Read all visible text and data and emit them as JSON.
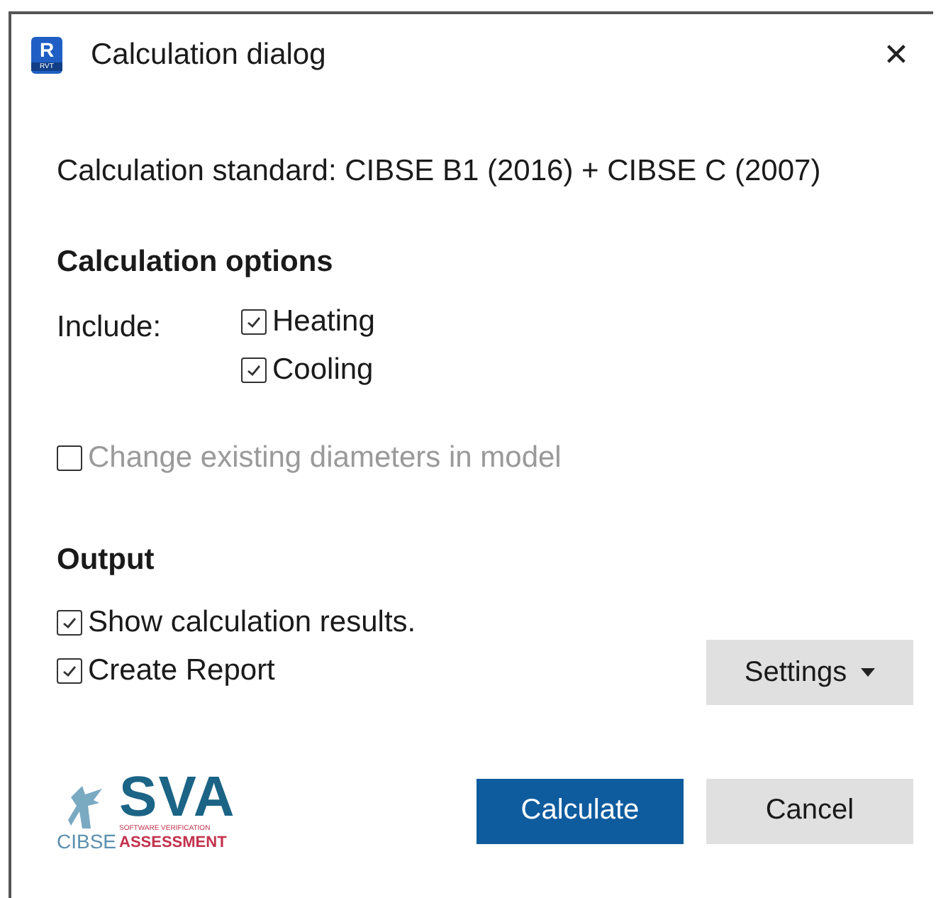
{
  "window": {
    "title": "Calculation dialog",
    "app_icon_letter": "R",
    "app_icon_caption": "RVT",
    "close": "✕"
  },
  "standard": "Calculation standard: CIBSE B1 (2016) + CIBSE C (2007)",
  "options": {
    "heading": "Calculation options",
    "include_label": "Include:",
    "items": [
      {
        "label": "Heating",
        "checked": true,
        "disabled": false
      },
      {
        "label": "Cooling",
        "checked": true,
        "disabled": false
      }
    ]
  },
  "change_diameters": {
    "label": "Change existing diameters in model",
    "checked": false,
    "disabled": true
  },
  "output": {
    "heading": "Output",
    "items": [
      {
        "label": "Show calculation results.",
        "checked": true,
        "disabled": false
      },
      {
        "label": "Create Report",
        "checked": true,
        "disabled": false
      }
    ],
    "settings_button": "Settings"
  },
  "logo": {
    "org": "CIBSE",
    "mark": "SVA",
    "line1": "SOFTWARE VERIFICATION",
    "line2": "ASSESSMENT"
  },
  "buttons": [
    {
      "label": "Calculate",
      "kind": "primary"
    },
    {
      "label": "Cancel",
      "kind": "secondary"
    }
  ]
}
